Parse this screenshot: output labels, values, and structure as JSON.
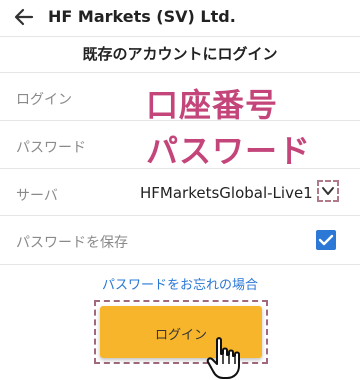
{
  "appbar": {
    "title": "HF Markets (SV) Ltd.",
    "back_icon": "arrow-left-icon"
  },
  "section": {
    "title": "既存のアカウントにログイン"
  },
  "form": {
    "login_label": "ログイン",
    "password_label": "パスワード",
    "server_label": "サーバ",
    "server_value": "HFMarketsGlobal-Live1",
    "save_password_label": "パスワードを保存",
    "save_password_checked": true
  },
  "annotations": {
    "account_number": "口座番号",
    "password": "パスワード"
  },
  "forgot_password": "パスワードをお忘れの場合",
  "login_button": {
    "label": "ログイン"
  },
  "colors": {
    "accent_blue": "#2b78d6",
    "button_yellow": "#f7b52b",
    "annotation_pink": "#c4457a"
  }
}
